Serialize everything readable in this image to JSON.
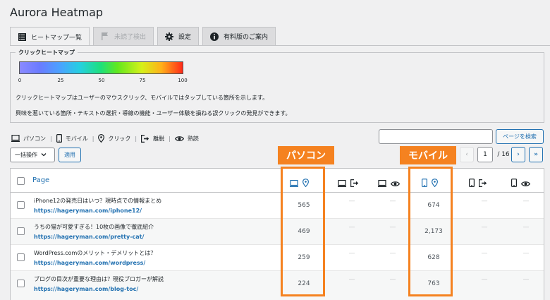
{
  "app_title": "Aurora Heatmap",
  "tabs": [
    {
      "label": "ヒートマップ一覧"
    },
    {
      "label": "未読了検出"
    },
    {
      "label": "設定"
    },
    {
      "label": "有料版のご案内"
    }
  ],
  "legend": {
    "title": "クリックヒートマップ",
    "ticks": [
      "0",
      "25",
      "50",
      "75",
      "100"
    ],
    "desc1": "クリックヒートマップはユーザーのマウスクリック、モバイルではタップしている箇所を示します。",
    "desc2": "興味を惹いている箇所・テキストの選択・導線の機能・ユーザー体験を損ねる誤クリックの発見ができます。"
  },
  "icon_legend": {
    "pc": "パソコン",
    "mobile": "モバイル",
    "click": "クリック",
    "leave": "離脱",
    "read": "熟読"
  },
  "search": {
    "button": "ページを検索",
    "value": ""
  },
  "bulk": {
    "select": "一括操作",
    "apply": "適用"
  },
  "pagination": {
    "prev": "‹",
    "current": "1",
    "total": "/ 16",
    "next": "›",
    "last": "»"
  },
  "table": {
    "page_header": "Page",
    "rows": [
      {
        "title": "iPhone12の発売日はいつ？現時点での情報まとめ",
        "url": "https://hageryman.com/iphone12/",
        "pc_click": "565",
        "pc_leave": "—",
        "pc_read": "—",
        "mb_click": "674",
        "mb_leave": "—",
        "mb_read": "—"
      },
      {
        "title": "うちの猫が可愛すぎる！10枚の画像で徹底紹介",
        "url": "https://hageryman.com/pretty-cat/",
        "pc_click": "469",
        "pc_leave": "—",
        "pc_read": "—",
        "mb_click": "2,173",
        "mb_leave": "—",
        "mb_read": "—"
      },
      {
        "title": "WordPress.comのメリット・デメリットとは？",
        "url": "https://hageryman.com/wordpress/",
        "pc_click": "259",
        "pc_leave": "—",
        "pc_read": "—",
        "mb_click": "628",
        "mb_leave": "—",
        "mb_read": "—"
      },
      {
        "title": "ブログの目次が重要な理由は？現役ブロガーが解説",
        "url": "https://hageryman.com/blog-toc/",
        "pc_click": "224",
        "pc_leave": "—",
        "pc_read": "—",
        "mb_click": "763",
        "mb_leave": "—",
        "mb_read": "—"
      }
    ]
  },
  "annotations": {
    "pc": "パソコン",
    "mobile": "モバイル"
  },
  "colors": {
    "accent": "#2271b1",
    "highlight": "#f58220"
  }
}
